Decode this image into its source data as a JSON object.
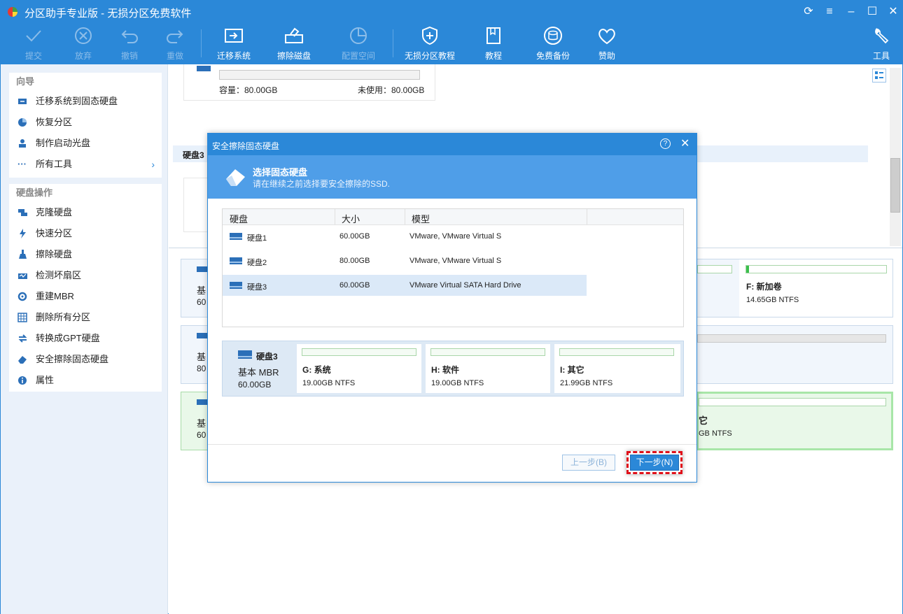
{
  "window": {
    "title": "分区助手专业版 - 无损分区免费软件",
    "controls": [
      "refresh",
      "menu",
      "minimize",
      "maximize",
      "close"
    ]
  },
  "toolbar": {
    "items": [
      {
        "label": "提交",
        "icon": "check-icon",
        "enabled": false
      },
      {
        "label": "放弃",
        "icon": "cancel-circle-icon",
        "enabled": false
      },
      {
        "label": "撤销",
        "icon": "undo-icon",
        "enabled": false
      },
      {
        "label": "重做",
        "icon": "redo-icon",
        "enabled": false
      },
      {
        "label": "迁移系统",
        "icon": "migrate-os-icon",
        "enabled": true
      },
      {
        "label": "擦除磁盘",
        "icon": "wipe-disk-icon",
        "enabled": true
      },
      {
        "label": "配置空间",
        "icon": "allocate-space-icon",
        "enabled": false
      },
      {
        "label": "无损分区教程",
        "icon": "shield-icon",
        "enabled": true
      },
      {
        "label": "教程",
        "icon": "book-icon",
        "enabled": true
      },
      {
        "label": "免费备份",
        "icon": "backup-icon",
        "enabled": true
      },
      {
        "label": "赞助",
        "icon": "heart-icon",
        "enabled": true
      },
      {
        "label": "工具",
        "icon": "wrench-icon",
        "enabled": true
      }
    ]
  },
  "sidebar": {
    "wizard": {
      "title": "向导",
      "items": [
        "迁移系统到固态硬盘",
        "恢复分区",
        "制作启动光盘",
        "所有工具"
      ]
    },
    "disk_ops": {
      "title": "硬盘操作",
      "items": [
        "克隆硬盘",
        "快速分区",
        "擦除硬盘",
        "检测坏扇区",
        "重建MBR",
        "删除所有分区",
        "转换成GPT硬盘",
        "安全擦除固态硬盘",
        "属性"
      ]
    }
  },
  "background": {
    "capacity_label": "容量：80.00GB",
    "unused_label": "未使用：80.00GB",
    "disk3_label": "硬盘3",
    "left_cards": [
      {
        "line1": "基",
        "line2": "60"
      },
      {
        "line1": "基",
        "line2": "80"
      },
      {
        "line1": "基",
        "line2": "60"
      }
    ],
    "f_name": "F: 新加卷",
    "f_size": "14.65GB NTFS",
    "c3_name": "它",
    "c3_size": "GB NTFS"
  },
  "dialog": {
    "title": "安全擦除固态硬盘",
    "help": "?",
    "header_title": "选择固态硬盘",
    "header_sub": "请在继续之前选择要安全擦除的SSD.",
    "columns": [
      "硬盘",
      "大小",
      "模型"
    ],
    "rows": [
      {
        "disk": "硬盘1",
        "size": "60.00GB",
        "model": "VMware, VMware Virtual S"
      },
      {
        "disk": "硬盘2",
        "size": "80.00GB",
        "model": "VMware, VMware Virtual S"
      },
      {
        "disk": "硬盘3",
        "size": "60.00GB",
        "model": "VMware Virtual SATA Hard Drive"
      }
    ],
    "selected_row": 2,
    "map": {
      "disk_name": "硬盘3",
      "disk_type": "基本 MBR",
      "disk_size": "60.00GB",
      "partitions": [
        {
          "name": "G: 系统",
          "size": "19.00GB NTFS"
        },
        {
          "name": "H: 软件",
          "size": "19.00GB NTFS"
        },
        {
          "name": "I: 其它",
          "size": "21.99GB NTFS"
        }
      ]
    },
    "prev_button": "上一步(B)",
    "next_button": "下一步(N)"
  },
  "colors": {
    "accent": "#2b88d8",
    "highlight": "#e0101a",
    "selected_row": "#dbe9f8"
  }
}
